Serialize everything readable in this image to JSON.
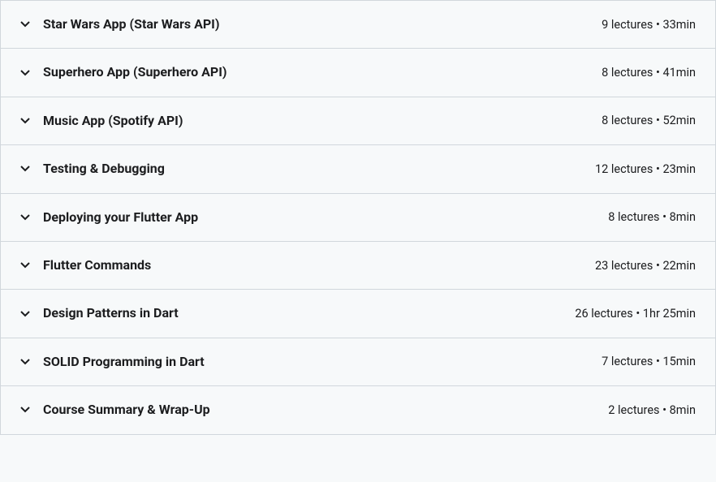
{
  "sections": [
    {
      "title": "Star Wars App (Star Wars API)",
      "meta": "9 lectures • 33min"
    },
    {
      "title": "Superhero App (Superhero API)",
      "meta": "8 lectures • 41min"
    },
    {
      "title": "Music App (Spotify API)",
      "meta": "8 lectures • 52min"
    },
    {
      "title": "Testing & Debugging",
      "meta": "12 lectures • 23min"
    },
    {
      "title": "Deploying your Flutter App",
      "meta": "8 lectures • 8min"
    },
    {
      "title": "Flutter Commands",
      "meta": "23 lectures • 22min"
    },
    {
      "title": "Design Patterns in Dart",
      "meta": "26 lectures • 1hr 25min"
    },
    {
      "title": "SOLID Programming in Dart",
      "meta": "7 lectures • 15min"
    },
    {
      "title": "Course Summary & Wrap-Up",
      "meta": "2 lectures • 8min"
    }
  ]
}
